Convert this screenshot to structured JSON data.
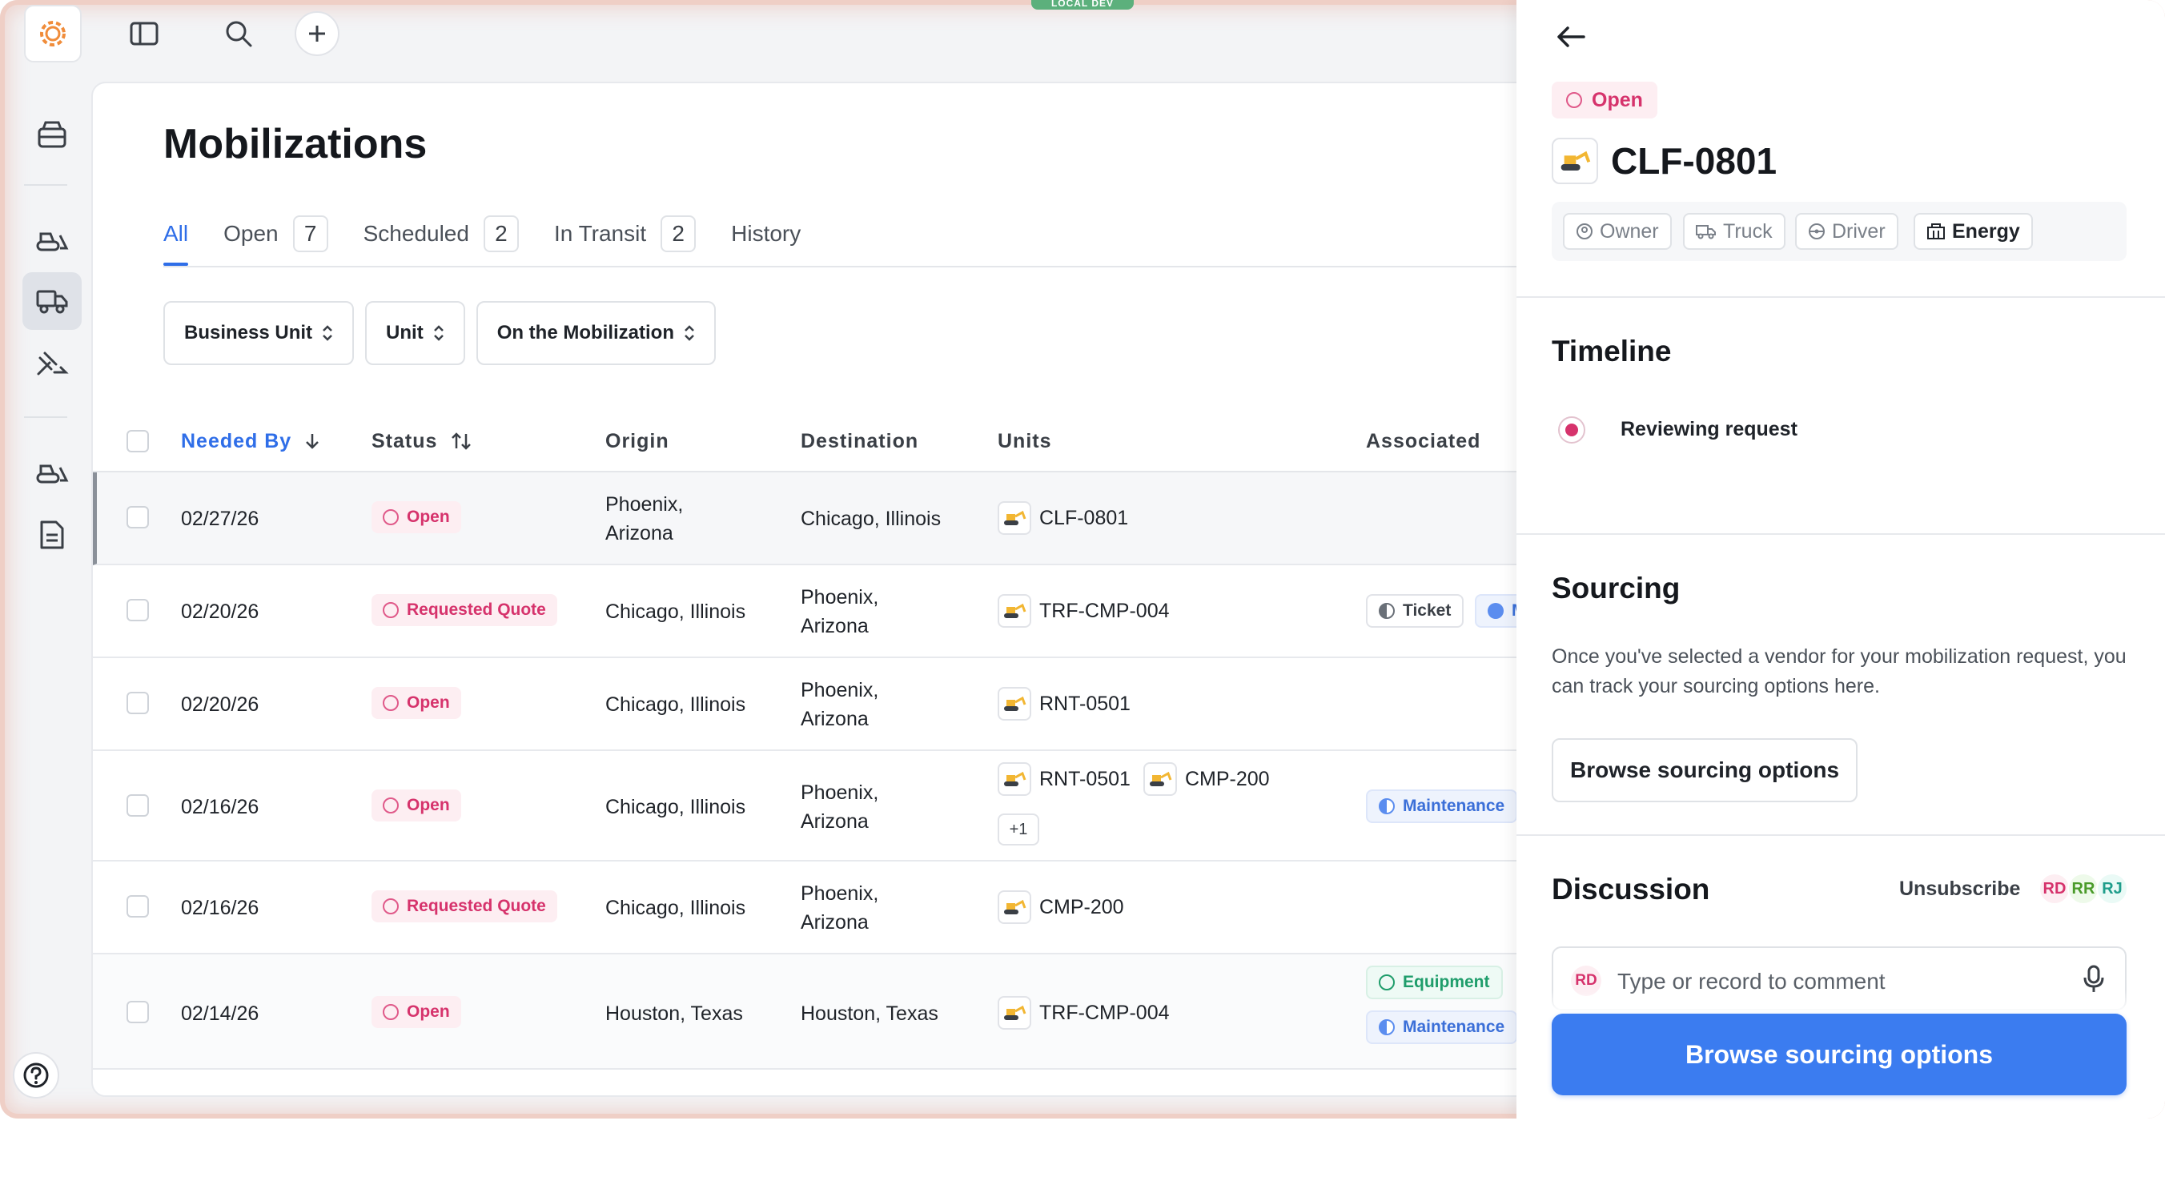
{
  "env_badge": "LOCAL DEV",
  "page": {
    "title": "Mobilizations",
    "tabs": [
      {
        "label": "All",
        "count": ""
      },
      {
        "label": "Open",
        "count": "7"
      },
      {
        "label": "Scheduled",
        "count": "2"
      },
      {
        "label": "In Transit",
        "count": "2"
      },
      {
        "label": "History",
        "count": ""
      }
    ],
    "filters": [
      "Business Unit",
      "Unit",
      "On the Mobilization"
    ]
  },
  "table": {
    "columns": [
      "Needed By",
      "Status",
      "Origin",
      "Destination",
      "Units",
      "Associated"
    ],
    "rows": [
      {
        "needed_by": "02/27/26",
        "status": "Open",
        "origin": "Phoenix, Arizona",
        "destination": "Chicago, Illinois",
        "units": [
          "CLF-0801"
        ],
        "more": "",
        "tags": []
      },
      {
        "needed_by": "02/20/26",
        "status": "Requested Quote",
        "origin": "Chicago, Illinois",
        "destination": "Phoenix, Arizona",
        "units": [
          "TRF-CMP-004"
        ],
        "more": "",
        "tags": [
          "Ticket",
          "M"
        ]
      },
      {
        "needed_by": "02/20/26",
        "status": "Open",
        "origin": "Chicago, Illinois",
        "destination": "Phoenix, Arizona",
        "units": [
          "RNT-0501"
        ],
        "more": "",
        "tags": []
      },
      {
        "needed_by": "02/16/26",
        "status": "Open",
        "origin": "Chicago, Illinois",
        "destination": "Phoenix, Arizona",
        "units": [
          "RNT-0501",
          "CMP-200"
        ],
        "more": "+1",
        "tags": [
          "Maintenance"
        ]
      },
      {
        "needed_by": "02/16/26",
        "status": "Requested Quote",
        "origin": "Chicago, Illinois",
        "destination": "Phoenix, Arizona",
        "units": [
          "CMP-200"
        ],
        "more": "",
        "tags": []
      },
      {
        "needed_by": "02/14/26",
        "status": "Open",
        "origin": "Houston, Texas",
        "destination": "Houston, Texas",
        "units": [
          "TRF-CMP-004"
        ],
        "more": "",
        "tags": [
          "Equipment",
          "Maintenance"
        ]
      }
    ]
  },
  "panel": {
    "status": "Open",
    "unit_title": "CLF-0801",
    "quick_actions": [
      "Owner",
      "Truck",
      "Driver",
      "Energy"
    ],
    "timeline": {
      "title": "Timeline",
      "step": "Reviewing request"
    },
    "sourcing": {
      "title": "Sourcing",
      "text": "Once you've selected a vendor for your mobilization request, you can track your sourcing options here.",
      "button": "Browse sourcing options"
    },
    "discussion": {
      "title": "Discussion",
      "unsubscribe": "Unsubscribe",
      "avatars": [
        "RD",
        "RR",
        "RJ"
      ],
      "comment_avatar": "RD",
      "placeholder": "Type or record to comment"
    },
    "cta": "Browse sourcing options"
  },
  "colors": {
    "accent": "#3b7cf0",
    "open": "#d6336c",
    "maintenance": "#3b6fd8",
    "equipment": "#1f9d6b"
  }
}
